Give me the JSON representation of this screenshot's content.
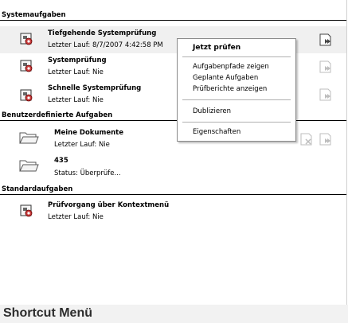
{
  "sections": {
    "system": "Systemaufgaben",
    "user": "Benutzerdefinierte Aufgaben",
    "standard": "Standardaufgaben"
  },
  "tasks": {
    "deep_scan": {
      "name": "Tiefgehende Systemprüfung",
      "status": "Letzter Lauf: 8/7/2007 4:42:58 PM"
    },
    "system_scan": {
      "name": "Systemprüfung",
      "status": "Letzter Lauf: Nie"
    },
    "quick_scan": {
      "name": "Schnelle Systemprüfung",
      "status": "Letzter Lauf: Nie"
    },
    "my_documents": {
      "name": "Meine Dokumente",
      "status": "Letzter Lauf: Nie"
    },
    "task_435": {
      "name": "435",
      "status": "Status: Überprüfe..."
    },
    "context_scan": {
      "name": "Prüfvorgang über Kontextmenü",
      "status": "Letzter Lauf: Nie"
    }
  },
  "context_menu": {
    "scan_now": "Jetzt prüfen",
    "show_paths": "Aufgabenpfade zeigen",
    "scheduled_tasks": "Geplante Aufgaben",
    "show_reports": "Prüfberichte anzeigen",
    "duplicate": "Dublizieren",
    "properties": "Eigenschaften"
  },
  "caption": "Shortcut Menü",
  "icons": {
    "task": "scan-task-icon",
    "folder": "folder-icon",
    "run": "run-task-icon",
    "delete": "delete-task-icon"
  }
}
